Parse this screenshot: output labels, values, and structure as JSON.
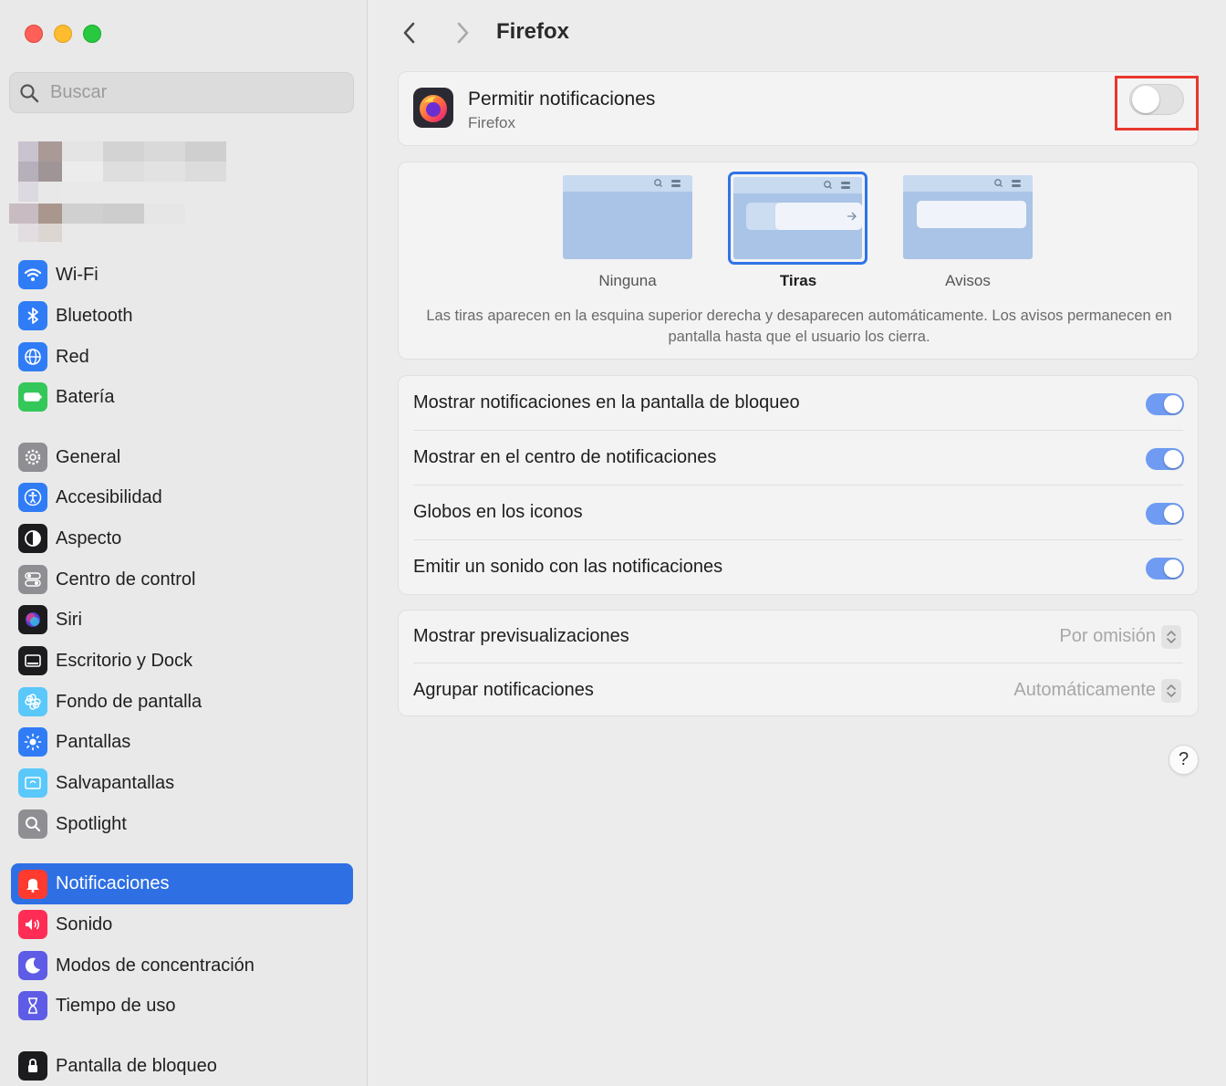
{
  "window": {
    "title": "Firefox"
  },
  "sidebar": {
    "search_placeholder": "Buscar",
    "items": [
      {
        "label": "Wi-Fi",
        "icon": "wifi-icon",
        "color": "#2f7cf6"
      },
      {
        "label": "Bluetooth",
        "icon": "bluetooth-icon",
        "color": "#2f7cf6"
      },
      {
        "label": "Red",
        "icon": "globe-icon",
        "color": "#2f7cf6"
      },
      {
        "label": "Batería",
        "icon": "battery-icon",
        "color": "#34c759"
      },
      {
        "label": "General",
        "icon": "gear-icon",
        "color": "#8e8e93"
      },
      {
        "label": "Accesibilidad",
        "icon": "accessibility-icon",
        "color": "#2f7cf6"
      },
      {
        "label": "Aspecto",
        "icon": "appearance-icon",
        "color": "#1c1c1e"
      },
      {
        "label": "Centro de control",
        "icon": "control-center-icon",
        "color": "#8e8e93"
      },
      {
        "label": "Siri",
        "icon": "siri-icon",
        "color": "#1c1c1e"
      },
      {
        "label": "Escritorio y Dock",
        "icon": "dock-icon",
        "color": "#1c1c1e"
      },
      {
        "label": "Fondo de pantalla",
        "icon": "wallpaper-icon",
        "color": "#5ac8fa"
      },
      {
        "label": "Pantallas",
        "icon": "display-icon",
        "color": "#2f7cf6"
      },
      {
        "label": "Salvapantallas",
        "icon": "screensaver-icon",
        "color": "#5ac8fa"
      },
      {
        "label": "Spotlight",
        "icon": "spotlight-icon",
        "color": "#8e8e93"
      },
      {
        "label": "Notificaciones",
        "icon": "bell-icon",
        "color": "#ff3b30",
        "active": true
      },
      {
        "label": "Sonido",
        "icon": "speaker-icon",
        "color": "#ff2d55"
      },
      {
        "label": "Modos de concentración",
        "icon": "moon-icon",
        "color": "#5e5ce6"
      },
      {
        "label": "Tiempo de uso",
        "icon": "hourglass-icon",
        "color": "#5e5ce6"
      },
      {
        "label": "Pantalla de bloqueo",
        "icon": "lock-icon",
        "color": "#1c1c1e"
      }
    ]
  },
  "app": {
    "title": "Permitir notificaciones",
    "subtitle": "Firefox",
    "allow_enabled": false
  },
  "styles": {
    "options": [
      "Ninguna",
      "Tiras",
      "Avisos"
    ],
    "selected": "Tiras",
    "description": "Las tiras aparecen en la esquina superior derecha y desaparecen automáticamente. Los avisos permanecen en pantalla hasta que el usuario los cierra."
  },
  "toggles": [
    {
      "label": "Mostrar notificaciones en la pantalla de bloqueo",
      "on": true
    },
    {
      "label": "Mostrar en el centro de notificaciones",
      "on": true
    },
    {
      "label": "Globos en los iconos",
      "on": true
    },
    {
      "label": "Emitir un sonido con las notificaciones",
      "on": true
    }
  ],
  "selects": [
    {
      "label": "Mostrar previsualizaciones",
      "value": "Por omisión"
    },
    {
      "label": "Agrupar notificaciones",
      "value": "Automáticamente"
    }
  ],
  "help_label": "?",
  "colors": {
    "accent": "#2e6fe3",
    "highlight": "#e8372c",
    "toggle_on": "#6f9cf2"
  }
}
